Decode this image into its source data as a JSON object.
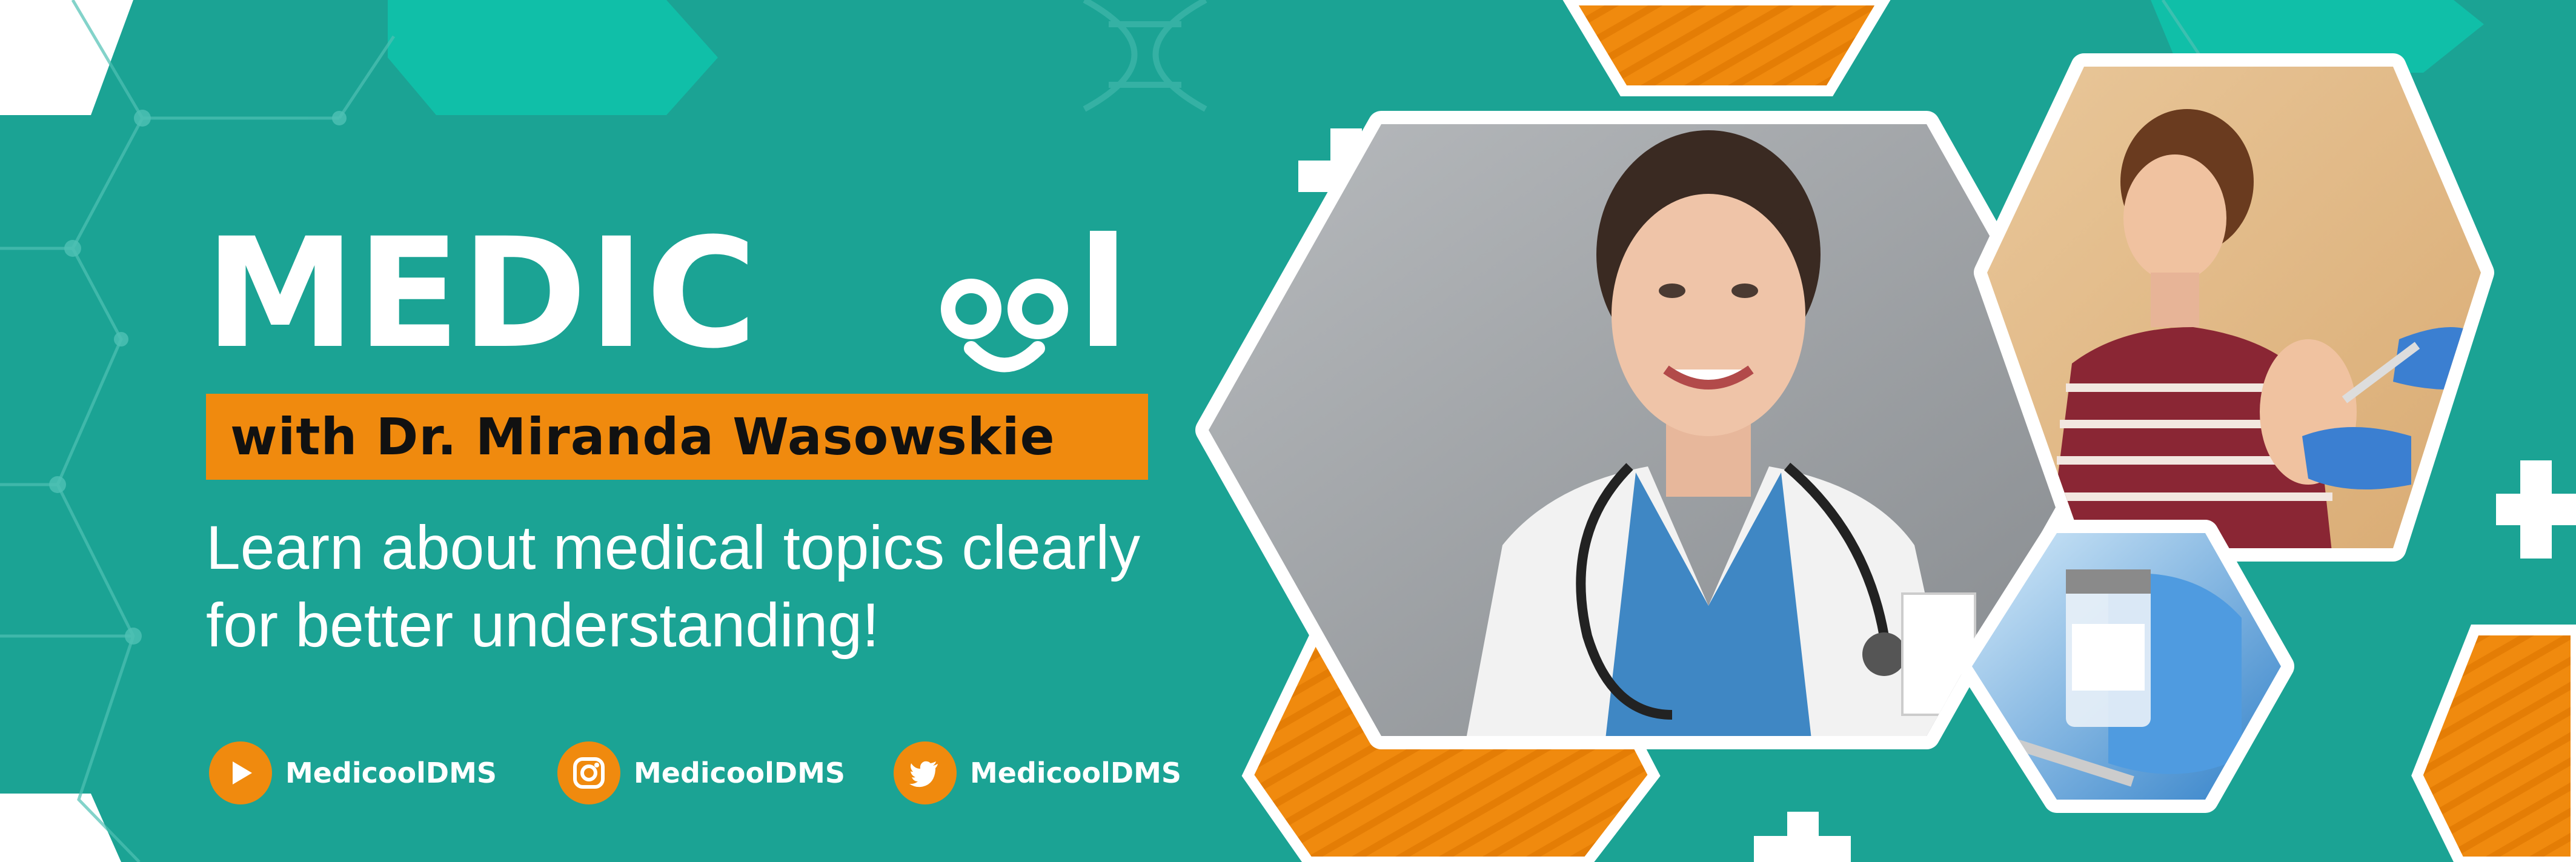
{
  "brand": {
    "logo_text": "MEDIC",
    "logo_tail": "l",
    "tagline": "with Dr. Miranda Wasowskie",
    "description_line1": "Learn about medical topics clearly",
    "description_line2": "for better understanding!"
  },
  "social": [
    {
      "icon": "play-icon",
      "label": "MedicoolDMS"
    },
    {
      "icon": "instagram-icon",
      "label": "MedicoolDMS"
    },
    {
      "icon": "twitter-icon",
      "label": "MedicoolDMS"
    }
  ],
  "colors": {
    "background": "#1ba394",
    "accent_orange": "#f08a0e",
    "light_teal": "#0fc7b0",
    "white": "#ffffff"
  },
  "images": [
    "doctor-photo",
    "boy-vaccination-photo",
    "vaccine-vial-photo"
  ]
}
